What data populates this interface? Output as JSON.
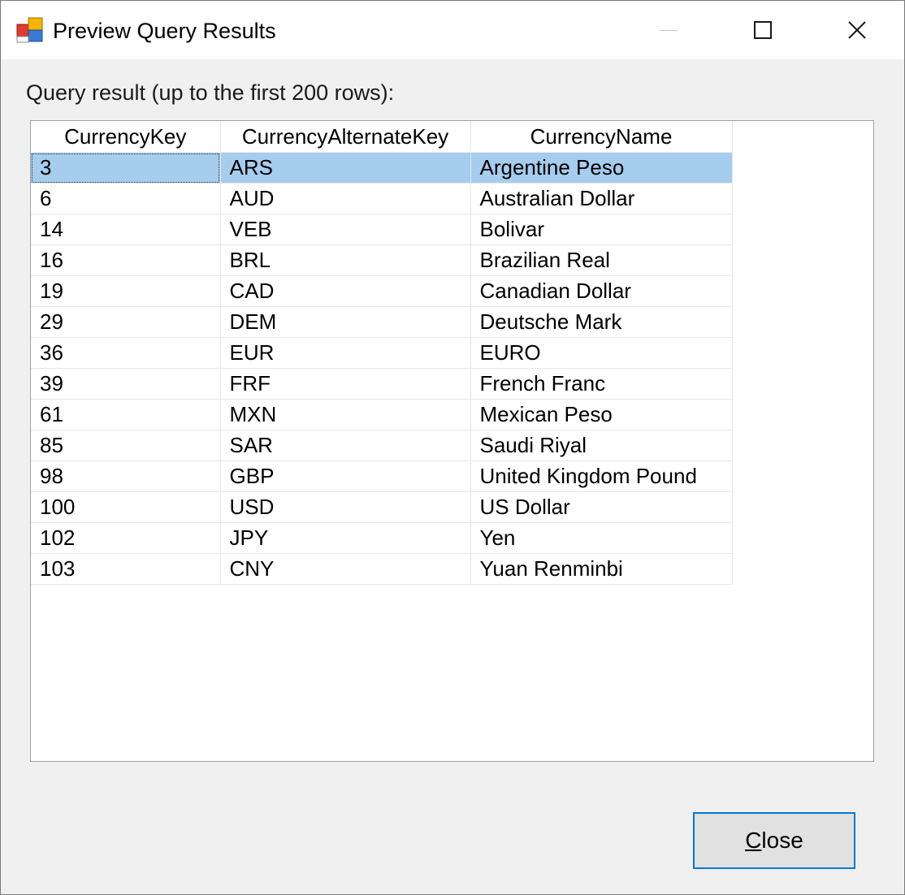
{
  "window": {
    "title": "Preview Query Results",
    "icon": "app-form-icon",
    "buttons": {
      "minimize": "minimize-icon",
      "maximize": "maximize-icon",
      "close": "close-icon"
    }
  },
  "main": {
    "query_label": "Query result (up to the first 200 rows):"
  },
  "grid": {
    "columns": [
      "CurrencyKey",
      "CurrencyAlternateKey",
      "CurrencyName"
    ],
    "selected_row_index": 0,
    "rows": [
      [
        "3",
        "ARS",
        "Argentine Peso"
      ],
      [
        "6",
        "AUD",
        "Australian Dollar"
      ],
      [
        "14",
        "VEB",
        "Bolivar"
      ],
      [
        "16",
        "BRL",
        "Brazilian Real"
      ],
      [
        "19",
        "CAD",
        "Canadian Dollar"
      ],
      [
        "29",
        "DEM",
        "Deutsche Mark"
      ],
      [
        "36",
        "EUR",
        "EURO"
      ],
      [
        "39",
        "FRF",
        "French Franc"
      ],
      [
        "61",
        "MXN",
        "Mexican Peso"
      ],
      [
        "85",
        "SAR",
        "Saudi Riyal"
      ],
      [
        "98",
        "GBP",
        "United Kingdom Pound"
      ],
      [
        "100",
        "USD",
        "US Dollar"
      ],
      [
        "102",
        "JPY",
        "Yen"
      ],
      [
        "103",
        "CNY",
        "Yuan Renminbi"
      ]
    ]
  },
  "footer": {
    "close_label_mnemonic": "C",
    "close_label_rest": "lose"
  },
  "colors": {
    "selection": "#a6cdee",
    "focus_border": "#0078d7",
    "window_bg": "#f0f0f0"
  }
}
